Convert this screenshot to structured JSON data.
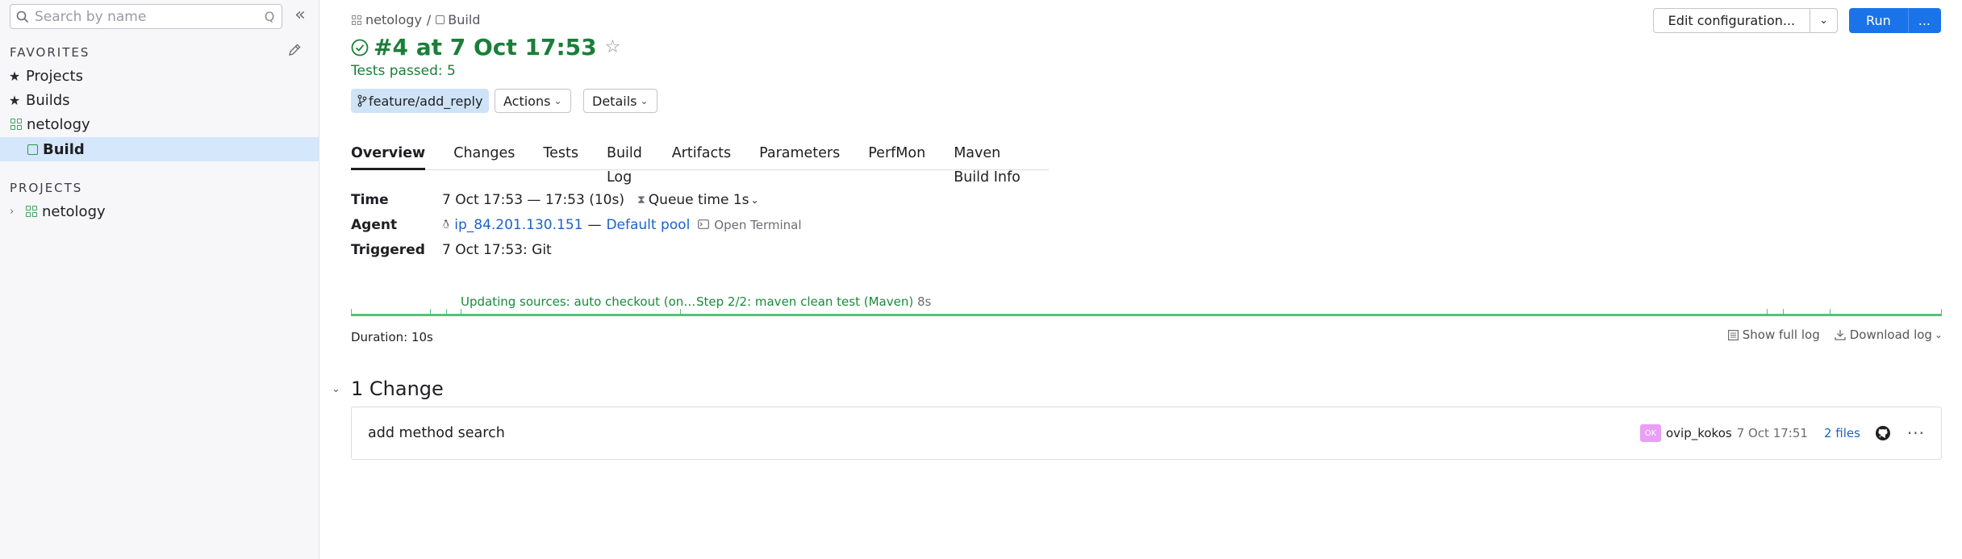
{
  "sidebar": {
    "search_placeholder": "Search by name",
    "search_shortcut": "Q",
    "favorites_title": "FAVORITES",
    "favorites": [
      {
        "label": "Projects"
      },
      {
        "label": "Builds"
      },
      {
        "label": "netology"
      },
      {
        "label": "Build"
      }
    ],
    "projects_title": "PROJECTS",
    "projects": [
      {
        "label": "netology"
      }
    ]
  },
  "header": {
    "breadcrumb": {
      "project": "netology",
      "separator": "/",
      "config": "Build"
    },
    "title": "#4 at 7 Oct 17:53",
    "tests_status": "Tests passed: 5",
    "branch": "feature/add_reply",
    "actions_label": "Actions",
    "details_label": "Details",
    "edit_config_label": "Edit configuration...",
    "run_label": "Run",
    "more_label": "..."
  },
  "tabs": [
    {
      "label": "Overview"
    },
    {
      "label": "Changes"
    },
    {
      "label": "Tests"
    },
    {
      "label": "Build Log"
    },
    {
      "label": "Artifacts"
    },
    {
      "label": "Parameters"
    },
    {
      "label": "PerfMon"
    },
    {
      "label": "Maven Build Info"
    }
  ],
  "overview": {
    "time_label": "Time",
    "time_value": "7 Oct 17:53 — 17:53 (10s)",
    "queue_time": "Queue time 1s",
    "agent_label": "Agent",
    "agent_name": "ip_84.201.130.151",
    "agent_sep": "—",
    "agent_pool": "Default pool",
    "open_terminal": "Open Terminal",
    "triggered_label": "Triggered",
    "triggered_value": "7 Oct 17:53: Git"
  },
  "timeline": {
    "step1": "Updating sources: auto checkout (on…",
    "step2": "Step 2/2: maven clean test (Maven)",
    "step2_duration": "8s"
  },
  "log": {
    "duration": "Duration: 10s",
    "show_full_log": "Show full log",
    "download_log": "Download log"
  },
  "changes": {
    "heading": "1 Change",
    "items": [
      {
        "message": "add method search",
        "avatar_initials": "OK",
        "author": "ovip_kokos",
        "time": "7 Oct 17:51",
        "files": "2 files"
      }
    ]
  },
  "colors": {
    "success": "#1a7f38",
    "accent": "#1a73e8",
    "active_nav": "#d4e7fb",
    "branch_chip": "#cfe3f7",
    "timeline": "#55c277"
  }
}
